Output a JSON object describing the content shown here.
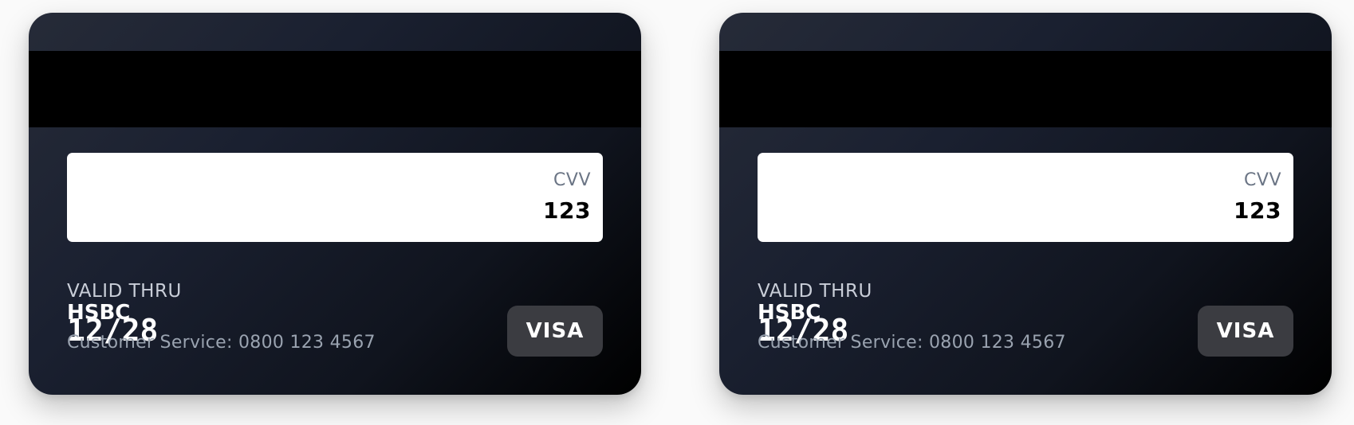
{
  "cards": [
    {
      "cvv_label": "CVV",
      "cvv": "123",
      "valid_thru_label": "VALID THRU",
      "bank": "HSBC",
      "expiry": "12/28",
      "customer_service": "Customer Service: 0800 123 4567",
      "brand": "VISA"
    },
    {
      "cvv_label": "CVV",
      "cvv": "123",
      "valid_thru_label": "VALID THRU",
      "bank": "HSBC",
      "expiry": "12/28",
      "customer_service": "Customer Service: 0800 123 4567",
      "brand": "VISA"
    }
  ],
  "colors": {
    "card_top": "#262b38",
    "card_bottom": "#000000",
    "magstripe": "#000000",
    "signature_panel": "#ffffff",
    "badge": "#3b3c41"
  }
}
